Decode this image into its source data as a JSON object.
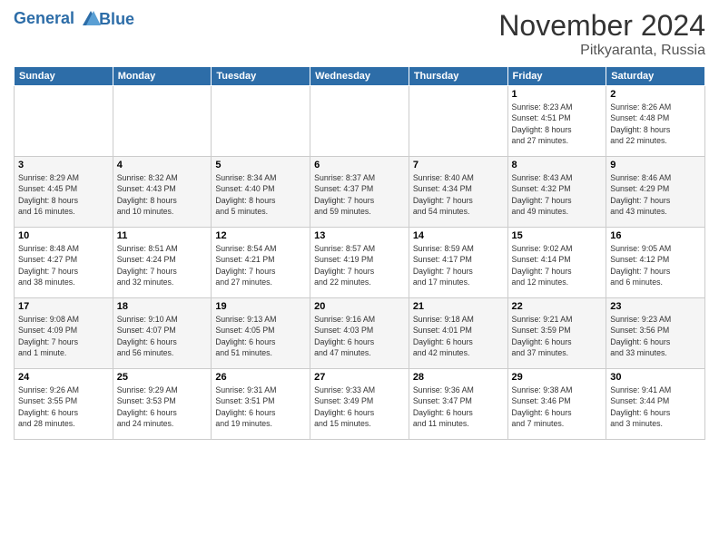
{
  "header": {
    "logo_line1": "General",
    "logo_line2": "Blue",
    "month": "November 2024",
    "location": "Pitkyaranta, Russia"
  },
  "weekdays": [
    "Sunday",
    "Monday",
    "Tuesday",
    "Wednesday",
    "Thursday",
    "Friday",
    "Saturday"
  ],
  "weeks": [
    [
      {
        "day": "",
        "info": ""
      },
      {
        "day": "",
        "info": ""
      },
      {
        "day": "",
        "info": ""
      },
      {
        "day": "",
        "info": ""
      },
      {
        "day": "",
        "info": ""
      },
      {
        "day": "1",
        "info": "Sunrise: 8:23 AM\nSunset: 4:51 PM\nDaylight: 8 hours\nand 27 minutes."
      },
      {
        "day": "2",
        "info": "Sunrise: 8:26 AM\nSunset: 4:48 PM\nDaylight: 8 hours\nand 22 minutes."
      }
    ],
    [
      {
        "day": "3",
        "info": "Sunrise: 8:29 AM\nSunset: 4:45 PM\nDaylight: 8 hours\nand 16 minutes."
      },
      {
        "day": "4",
        "info": "Sunrise: 8:32 AM\nSunset: 4:43 PM\nDaylight: 8 hours\nand 10 minutes."
      },
      {
        "day": "5",
        "info": "Sunrise: 8:34 AM\nSunset: 4:40 PM\nDaylight: 8 hours\nand 5 minutes."
      },
      {
        "day": "6",
        "info": "Sunrise: 8:37 AM\nSunset: 4:37 PM\nDaylight: 7 hours\nand 59 minutes."
      },
      {
        "day": "7",
        "info": "Sunrise: 8:40 AM\nSunset: 4:34 PM\nDaylight: 7 hours\nand 54 minutes."
      },
      {
        "day": "8",
        "info": "Sunrise: 8:43 AM\nSunset: 4:32 PM\nDaylight: 7 hours\nand 49 minutes."
      },
      {
        "day": "9",
        "info": "Sunrise: 8:46 AM\nSunset: 4:29 PM\nDaylight: 7 hours\nand 43 minutes."
      }
    ],
    [
      {
        "day": "10",
        "info": "Sunrise: 8:48 AM\nSunset: 4:27 PM\nDaylight: 7 hours\nand 38 minutes."
      },
      {
        "day": "11",
        "info": "Sunrise: 8:51 AM\nSunset: 4:24 PM\nDaylight: 7 hours\nand 32 minutes."
      },
      {
        "day": "12",
        "info": "Sunrise: 8:54 AM\nSunset: 4:21 PM\nDaylight: 7 hours\nand 27 minutes."
      },
      {
        "day": "13",
        "info": "Sunrise: 8:57 AM\nSunset: 4:19 PM\nDaylight: 7 hours\nand 22 minutes."
      },
      {
        "day": "14",
        "info": "Sunrise: 8:59 AM\nSunset: 4:17 PM\nDaylight: 7 hours\nand 17 minutes."
      },
      {
        "day": "15",
        "info": "Sunrise: 9:02 AM\nSunset: 4:14 PM\nDaylight: 7 hours\nand 12 minutes."
      },
      {
        "day": "16",
        "info": "Sunrise: 9:05 AM\nSunset: 4:12 PM\nDaylight: 7 hours\nand 6 minutes."
      }
    ],
    [
      {
        "day": "17",
        "info": "Sunrise: 9:08 AM\nSunset: 4:09 PM\nDaylight: 7 hours\nand 1 minute."
      },
      {
        "day": "18",
        "info": "Sunrise: 9:10 AM\nSunset: 4:07 PM\nDaylight: 6 hours\nand 56 minutes."
      },
      {
        "day": "19",
        "info": "Sunrise: 9:13 AM\nSunset: 4:05 PM\nDaylight: 6 hours\nand 51 minutes."
      },
      {
        "day": "20",
        "info": "Sunrise: 9:16 AM\nSunset: 4:03 PM\nDaylight: 6 hours\nand 47 minutes."
      },
      {
        "day": "21",
        "info": "Sunrise: 9:18 AM\nSunset: 4:01 PM\nDaylight: 6 hours\nand 42 minutes."
      },
      {
        "day": "22",
        "info": "Sunrise: 9:21 AM\nSunset: 3:59 PM\nDaylight: 6 hours\nand 37 minutes."
      },
      {
        "day": "23",
        "info": "Sunrise: 9:23 AM\nSunset: 3:56 PM\nDaylight: 6 hours\nand 33 minutes."
      }
    ],
    [
      {
        "day": "24",
        "info": "Sunrise: 9:26 AM\nSunset: 3:55 PM\nDaylight: 6 hours\nand 28 minutes."
      },
      {
        "day": "25",
        "info": "Sunrise: 9:29 AM\nSunset: 3:53 PM\nDaylight: 6 hours\nand 24 minutes."
      },
      {
        "day": "26",
        "info": "Sunrise: 9:31 AM\nSunset: 3:51 PM\nDaylight: 6 hours\nand 19 minutes."
      },
      {
        "day": "27",
        "info": "Sunrise: 9:33 AM\nSunset: 3:49 PM\nDaylight: 6 hours\nand 15 minutes."
      },
      {
        "day": "28",
        "info": "Sunrise: 9:36 AM\nSunset: 3:47 PM\nDaylight: 6 hours\nand 11 minutes."
      },
      {
        "day": "29",
        "info": "Sunrise: 9:38 AM\nSunset: 3:46 PM\nDaylight: 6 hours\nand 7 minutes."
      },
      {
        "day": "30",
        "info": "Sunrise: 9:41 AM\nSunset: 3:44 PM\nDaylight: 6 hours\nand 3 minutes."
      }
    ]
  ]
}
